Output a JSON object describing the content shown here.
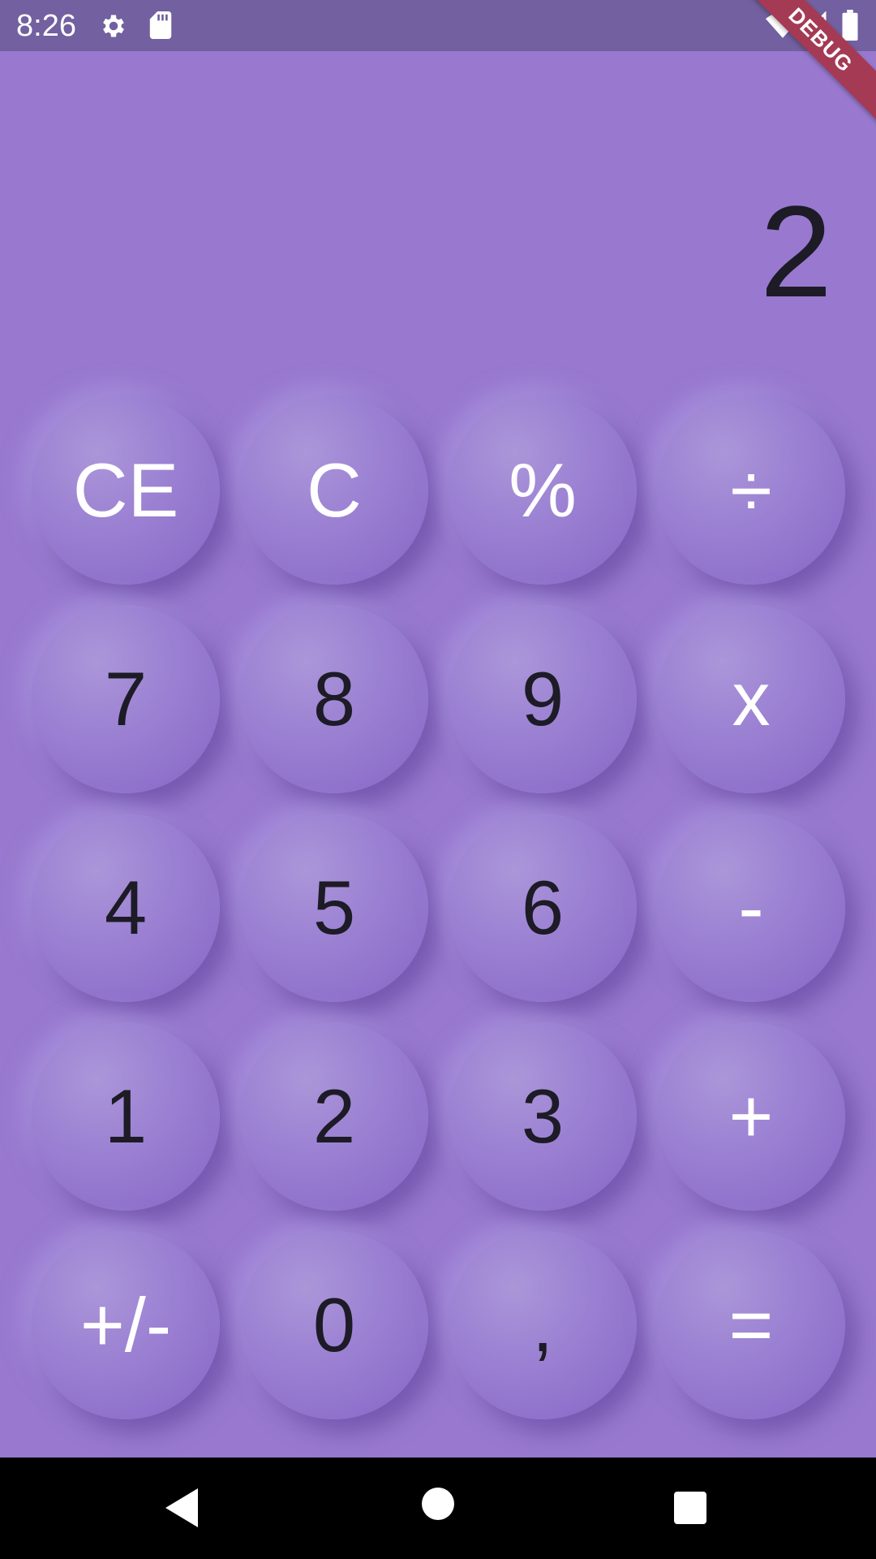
{
  "status_bar": {
    "time": "8:26",
    "icons": [
      "gear-icon",
      "sdcard-icon",
      "wifi-icon",
      "signal-icon",
      "battery-icon"
    ]
  },
  "debug_banner": "DEBUG",
  "display": {
    "value": "2"
  },
  "keys": [
    {
      "label": "CE",
      "style": "light"
    },
    {
      "label": "C",
      "style": "light"
    },
    {
      "label": "%",
      "style": "light"
    },
    {
      "label": "÷",
      "style": "light"
    },
    {
      "label": "7",
      "style": "dark"
    },
    {
      "label": "8",
      "style": "dark"
    },
    {
      "label": "9",
      "style": "dark"
    },
    {
      "label": "x",
      "style": "light"
    },
    {
      "label": "4",
      "style": "dark"
    },
    {
      "label": "5",
      "style": "dark"
    },
    {
      "label": "6",
      "style": "dark"
    },
    {
      "label": "-",
      "style": "light"
    },
    {
      "label": "1",
      "style": "dark"
    },
    {
      "label": "2",
      "style": "dark"
    },
    {
      "label": "3",
      "style": "dark"
    },
    {
      "label": "+",
      "style": "light"
    },
    {
      "label": "+/-",
      "style": "light"
    },
    {
      "label": "0",
      "style": "dark"
    },
    {
      "label": ",",
      "style": "dark"
    },
    {
      "label": "=",
      "style": "light"
    }
  ],
  "nav_bar": {
    "icons": [
      "back-icon",
      "home-icon",
      "recents-icon"
    ]
  },
  "colors": {
    "background": "#9879cf",
    "status_bar": "#7260a0",
    "debug_ribbon": "#a53a55",
    "digit_text": "#1d1b26",
    "operator_text": "#ffffff"
  }
}
